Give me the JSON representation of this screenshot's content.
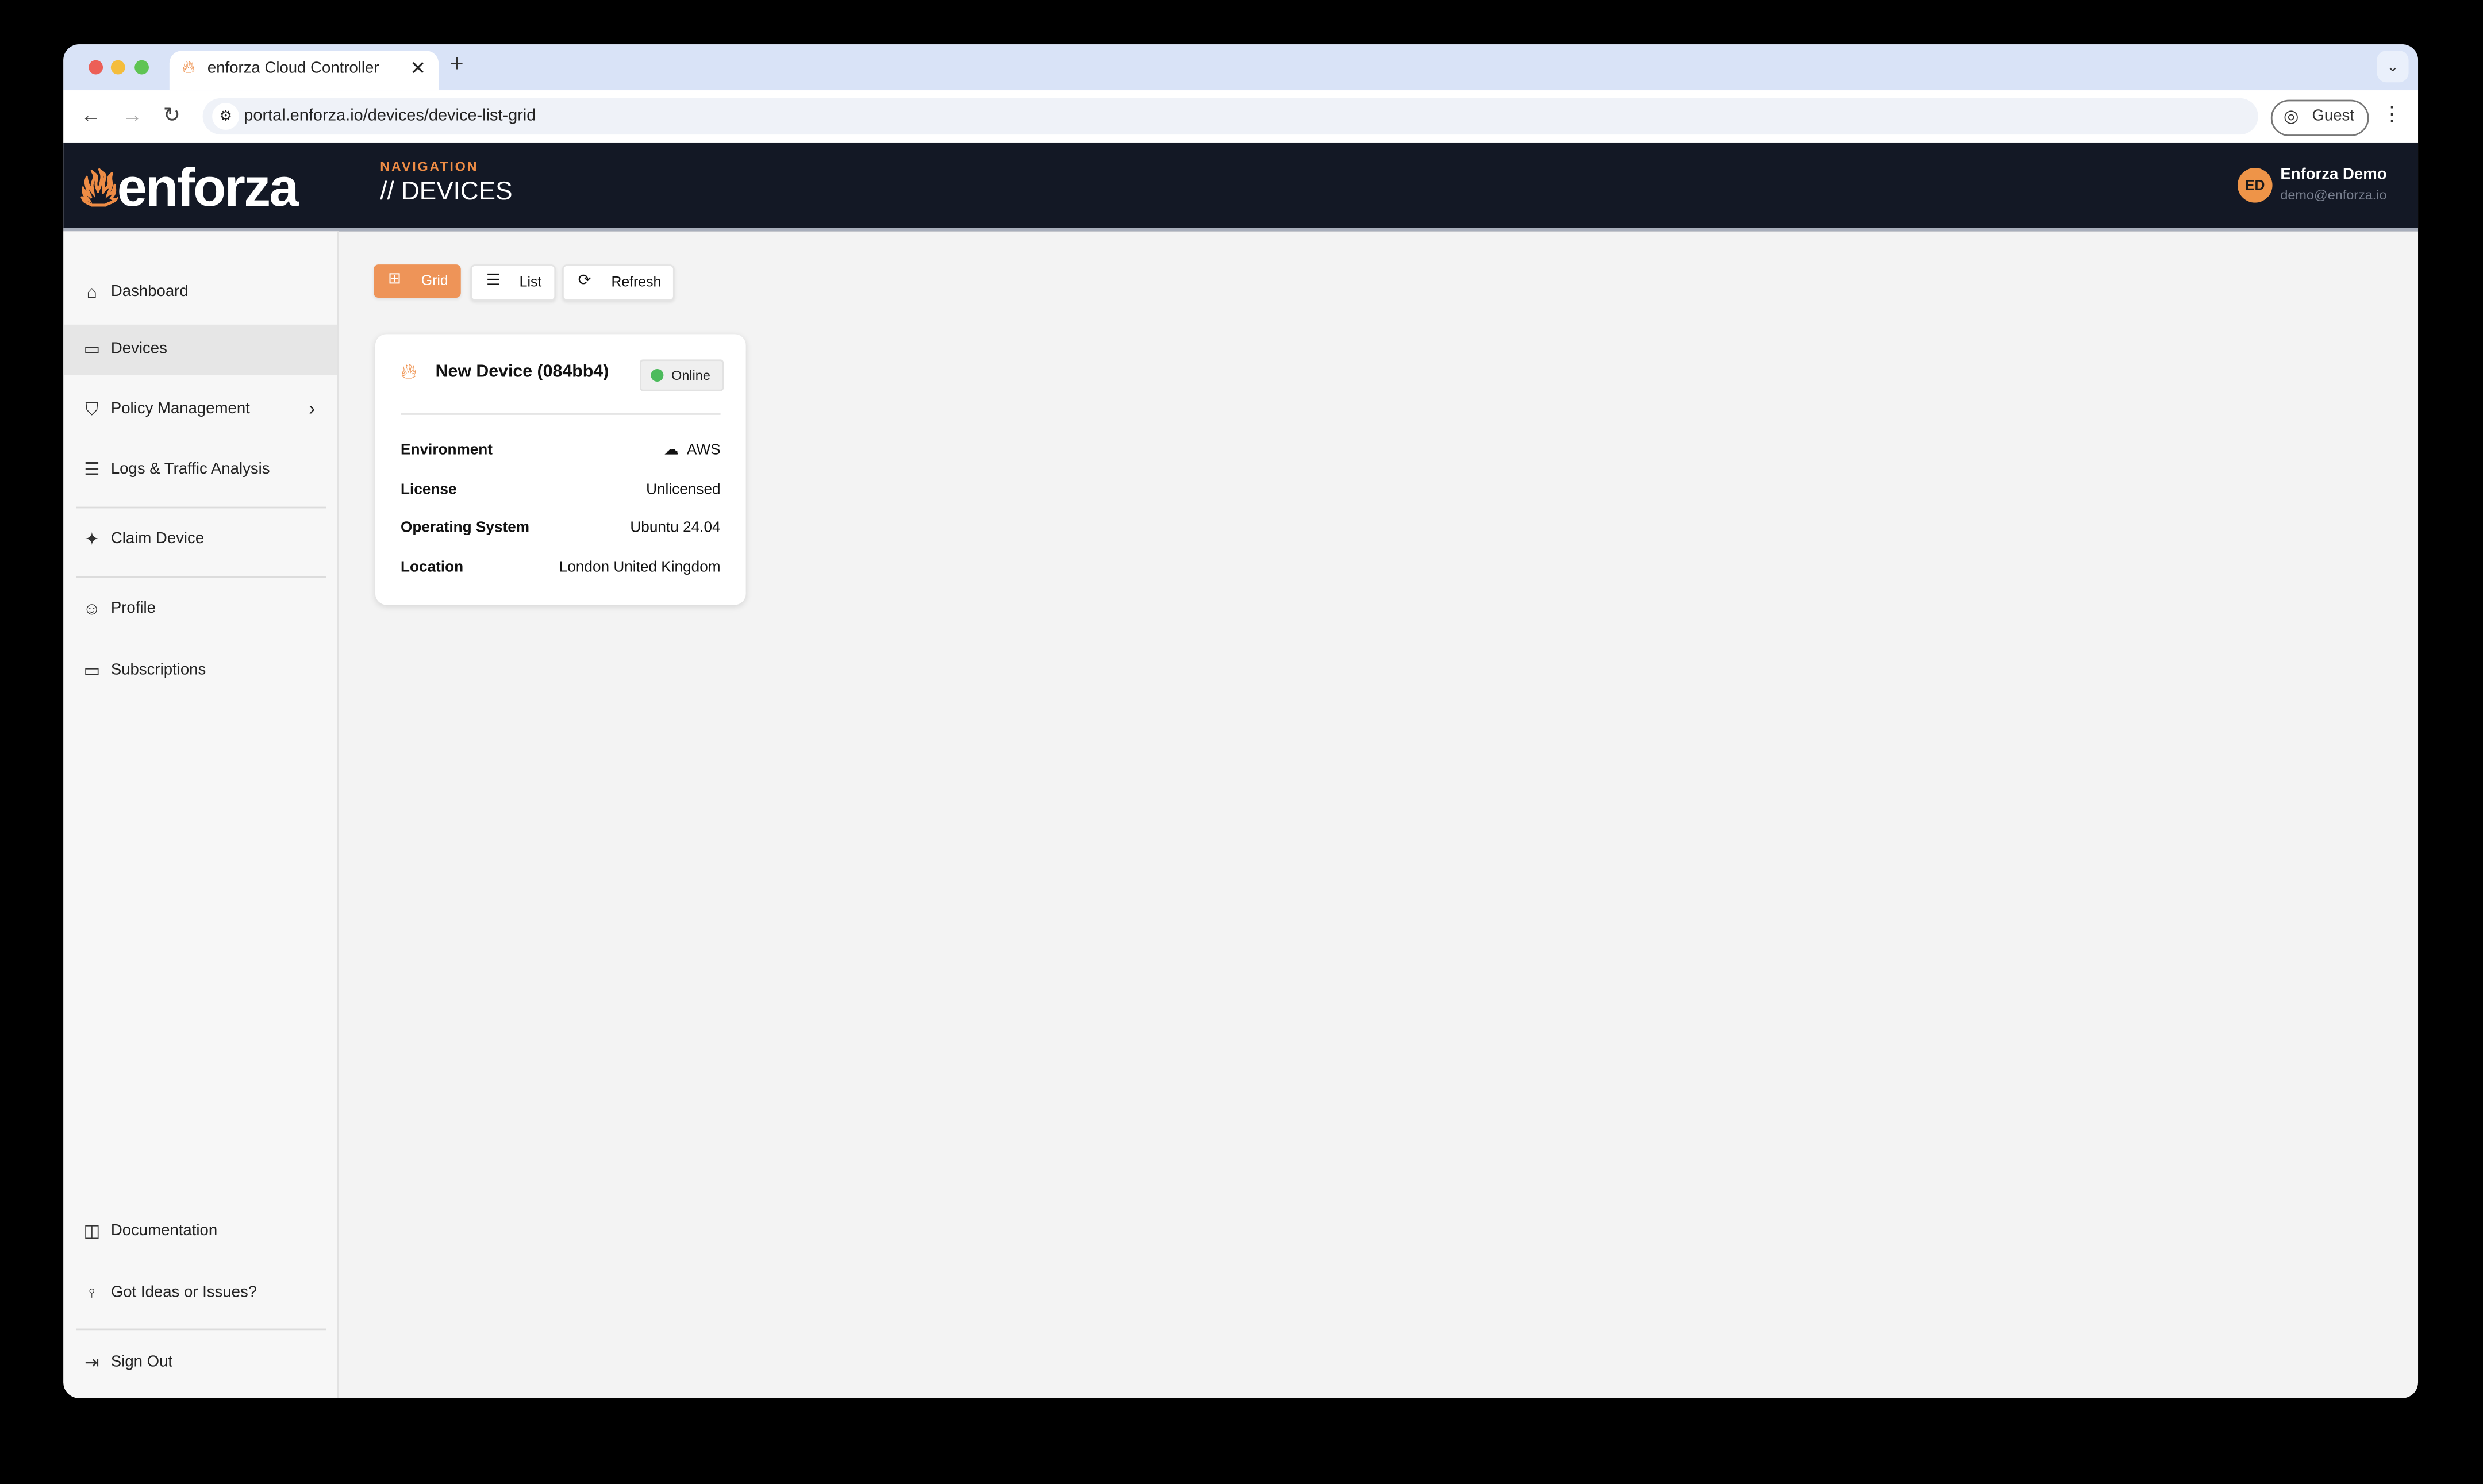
{
  "browser": {
    "tab_title": "enforza Cloud Controller",
    "url": "portal.enforza.io/devices/device-list-grid",
    "profile_label": "Guest"
  },
  "header": {
    "logo_text": "enforza",
    "nav_label": "NAVIGATION",
    "page_title": "// DEVICES",
    "user": {
      "initials": "ED",
      "name": "Enforza Demo",
      "email": "demo@enforza.io"
    }
  },
  "sidebar": {
    "items": [
      {
        "label": "Dashboard",
        "icon": "home-icon"
      },
      {
        "label": "Devices",
        "icon": "hard-drive-icon",
        "active": true
      },
      {
        "label": "Policy Management",
        "icon": "shield-icon"
      },
      {
        "label": "Logs & Traffic Analysis",
        "icon": "list-icon"
      },
      {
        "label": "Claim Device",
        "icon": "sparkle-icon"
      },
      {
        "label": "Profile",
        "icon": "user-edit-icon"
      },
      {
        "label": "Subscriptions",
        "icon": "credit-card-icon"
      }
    ],
    "footer": [
      {
        "label": "Documentation",
        "icon": "book-icon"
      },
      {
        "label": "Got Ideas or Issues?",
        "icon": "lightbulb-icon"
      },
      {
        "label": "Sign Out",
        "icon": "sign-out-icon"
      }
    ]
  },
  "toolbar": {
    "grid_label": "Grid",
    "list_label": "List",
    "refresh_label": "Refresh",
    "active_view": "Grid"
  },
  "colors": {
    "accent": "#ee8c45",
    "header_bg": "#131825",
    "online": "#4cbb5c"
  },
  "devices": [
    {
      "name": "New Device (084bb4)",
      "status": "Online",
      "fields": [
        {
          "label": "Environment",
          "value": "AWS",
          "icon": "cloud-icon"
        },
        {
          "label": "License",
          "value": "Unlicensed"
        },
        {
          "label": "Operating System",
          "value": "Ubuntu 24.04"
        },
        {
          "label": "Location",
          "value": "London United Kingdom"
        }
      ]
    }
  ]
}
